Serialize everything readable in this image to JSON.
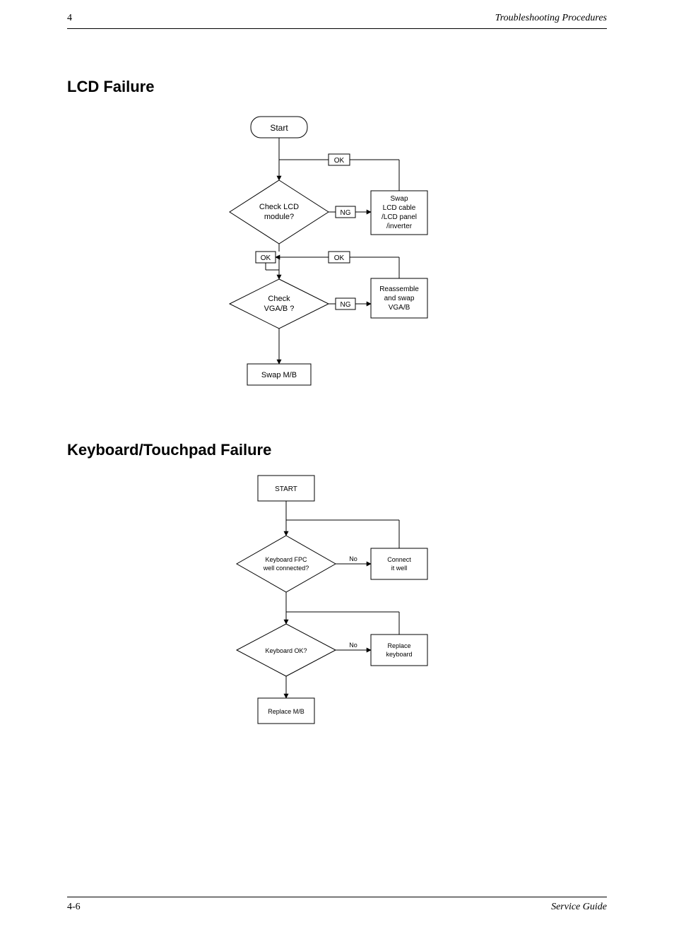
{
  "header": {
    "left": "4",
    "right": "Troubleshooting Procedures"
  },
  "footer": {
    "left": "4-6",
    "right": "Service Guide"
  },
  "section1": {
    "title": "LCD Failure"
  },
  "section2": {
    "title": "Keyboard/Touchpad Failure"
  },
  "flow1": {
    "start": "Start",
    "decision1": {
      "line1": "Check LCD",
      "line2": "module?"
    },
    "decision2": {
      "line1": "Check",
      "line2": "VGA/B ?"
    },
    "ok_label_top": "OK",
    "ng1": "NG",
    "ng2": "NG",
    "ok_small_mid_left": "OK",
    "ok_small_mid_right": "OK",
    "proc1": {
      "line1": "Swap",
      "line2": "LCD cable",
      "line3": "/LCD panel",
      "line4": "/inverter"
    },
    "proc2": {
      "line1": "Reassemble",
      "line2": "and swap",
      "line3": "VGA/B"
    },
    "end": "Swap M/B"
  },
  "flow2": {
    "start": "START",
    "decision1": {
      "line1": "Keyboard FPC",
      "line2": "well connected?"
    },
    "decision2": {
      "line1": "Keyboard OK?"
    },
    "no1": "No",
    "no2": "No",
    "proc1": {
      "line1": "Connect",
      "line2": "it well"
    },
    "proc2": {
      "line1": "Replace",
      "line2": "keyboard"
    },
    "end": "Replace M/B"
  }
}
